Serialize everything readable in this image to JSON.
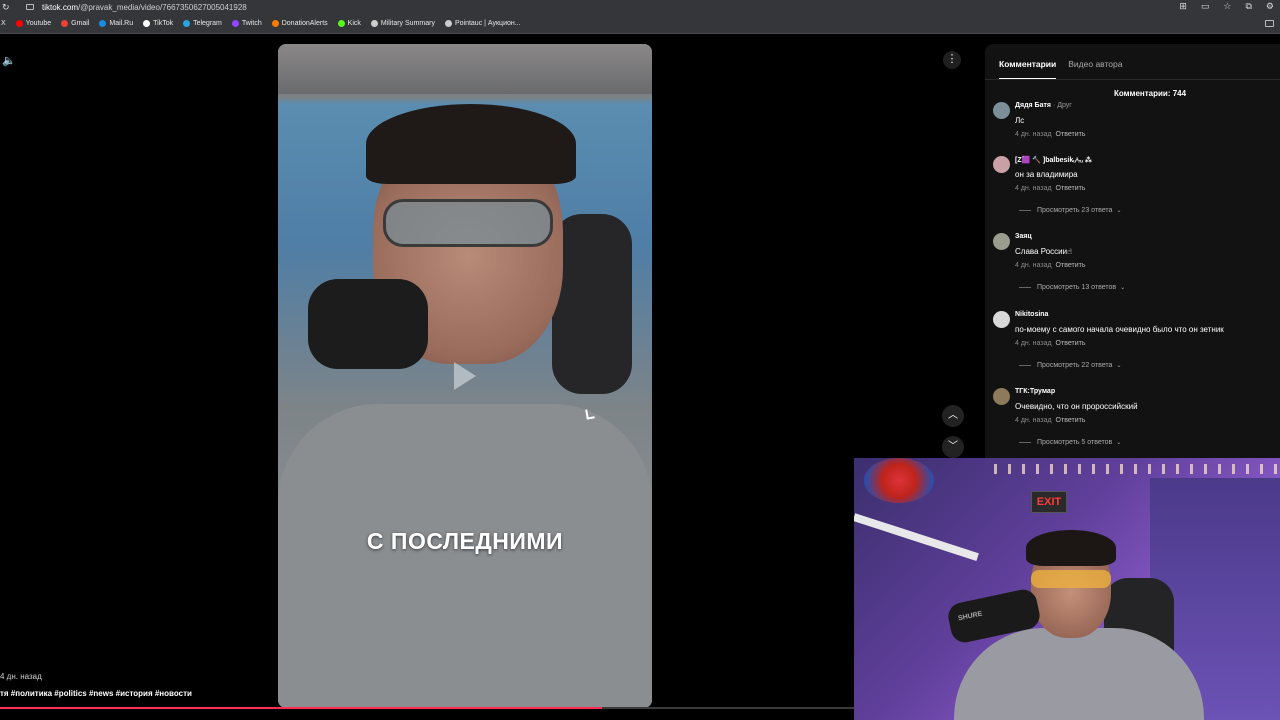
{
  "browser": {
    "url_domain": "tiktok.com",
    "url_path": "/@pravak_media/video/7667350627005041928",
    "bookmarks": [
      {
        "label": "X",
        "color": "#ffffff"
      },
      {
        "label": "Youtube",
        "color": "#ff0000"
      },
      {
        "label": "Gmail",
        "color": "#ea4335"
      },
      {
        "label": "Mail.Ru",
        "color": "#168de2"
      },
      {
        "label": "TikTok",
        "color": "#ffffff"
      },
      {
        "label": "Telegram",
        "color": "#2aa3df"
      },
      {
        "label": "Twitch",
        "color": "#9146ff"
      },
      {
        "label": "DonationAlerts",
        "color": "#f57d07"
      },
      {
        "label": "Kick",
        "color": "#53fc18"
      },
      {
        "label": "Military Summary",
        "color": "#cccccc"
      },
      {
        "label": "Pointauc | Аукцион...",
        "color": "#cccccc"
      }
    ]
  },
  "video": {
    "caption": "С ПОСЛЕДНИМИ",
    "posted": "4 дн. назад",
    "tags": "тя #политика #politics #news #история #новости",
    "progress_percent": 47
  },
  "panel": {
    "tabs": [
      {
        "label": "Комментарии",
        "active": true
      },
      {
        "label": "Видео автора",
        "active": false
      }
    ],
    "comment_count": "Комментарии: 744",
    "reply_label": "Ответить",
    "comments": [
      {
        "user": "Дядя Батя",
        "relation": "· Друг",
        "text": "Лс",
        "time": "4 дн. назад",
        "replies": "",
        "avatar_color": "#7b8f9a"
      },
      {
        "user": "[Z🟪 🔨 ]balbesikᵤᵃᵣᵤ ⁂",
        "relation": "",
        "text": "он за владимира",
        "time": "4 дн. назад",
        "replies": "Просмотреть 23 ответа",
        "avatar_color": "#c9a0a6"
      },
      {
        "user": "Заяц",
        "relation": "",
        "text": "Слава России☝",
        "time": "4 дн. назад",
        "replies": "Просмотреть 13 ответов",
        "avatar_color": "#9a9c8e"
      },
      {
        "user": "Nikitosina",
        "relation": "",
        "text": "по-моему с самого начала очевидно было что он зетник",
        "time": "4 дн. назад",
        "replies": "Просмотреть 22 ответа",
        "avatar_color": "#d8d8d8"
      },
      {
        "user": "ТГК:Трумар",
        "relation": "",
        "text": "Очевидно, что он пророссийский",
        "time": "4 дн. назад",
        "replies": "Просмотреть 5 ответов",
        "avatar_color": "#8c7a5a"
      }
    ]
  },
  "webcam": {
    "sign": "EXIT",
    "mic_brand": "SHURE"
  }
}
